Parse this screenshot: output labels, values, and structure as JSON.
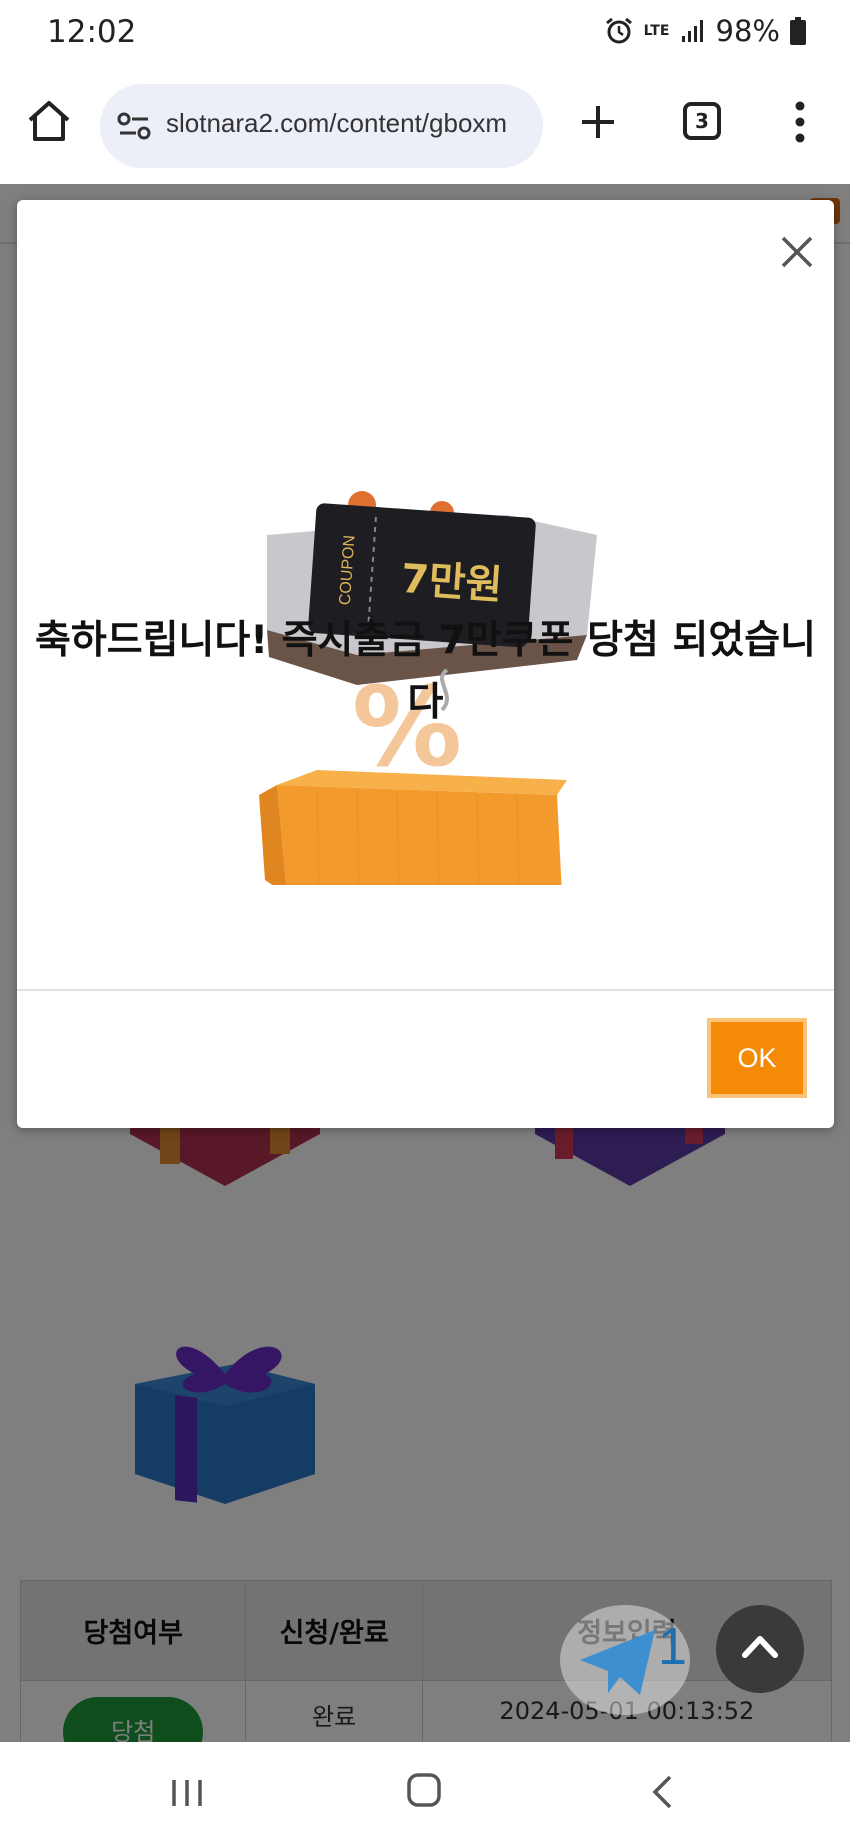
{
  "status_bar": {
    "time": "12:02",
    "network": "LTE",
    "battery": "98%"
  },
  "browser": {
    "url": "slotnara2.com/content/gboxm",
    "tab_count": "3"
  },
  "modal": {
    "message": "축하드립니다! 즉시출금 7만쿠폰 당첨 되었습니다",
    "coupon_label": "COUPON",
    "coupon_value": "7만원",
    "ok_label": "OK"
  },
  "table": {
    "headers": [
      "당첨여부",
      "신청/완료",
      "정보입력"
    ],
    "rows": [
      {
        "status": "당첨",
        "request": "완료",
        "info": "2024-05-01 00:13:52"
      }
    ]
  },
  "telegram": {
    "badge_count": "1"
  },
  "colors": {
    "accent": "#f58a07",
    "url_bg": "#eceef8",
    "win_green": "#1f9a3a"
  }
}
